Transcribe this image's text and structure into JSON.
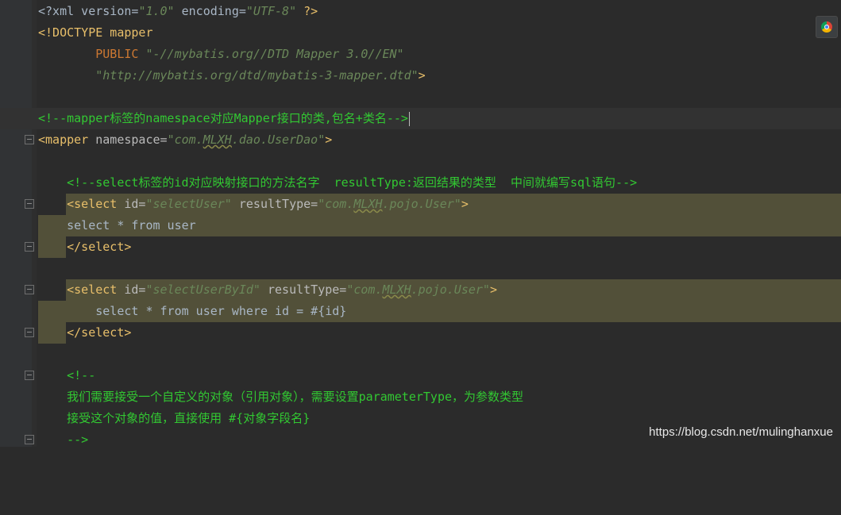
{
  "editor": {
    "lines": {
      "l1": {
        "a": "<?xml version=",
        "b": "\"1.0\"",
        "c": " encoding=",
        "d": "\"UTF-8\"",
        "e": " ?>"
      },
      "l2": {
        "a": "<!DOCTYPE mapper"
      },
      "l3": {
        "a": "        PUBLIC ",
        "b": "\"-//mybatis.org//DTD Mapper 3.0//EN\""
      },
      "l4": {
        "a": "        ",
        "b": "\"http://mybatis.org/dtd/mybatis-3-mapper.dtd\"",
        "c": ">"
      },
      "l6": {
        "a": "<!--mapper标签的namespace对应Mapper接口的类,包名+类名-->"
      },
      "l7": {
        "a": "<mapper",
        "b": " namespace=",
        "c": "\"com.",
        "d": "MLXH",
        "e": ".dao.UserDao\"",
        "f": ">"
      },
      "l9": {
        "a": "    <!--select标签的id对应映射接口的方法名字  resultType:返回结果的类型  中间就编写sql语句-->"
      },
      "l10": {
        "a": "    ",
        "b": "<select",
        "c": " id=",
        "d": "\"selectUser\"",
        "e": " resultType=",
        "f": "\"com.",
        "g": "MLXH",
        "h": ".pojo.User\"",
        "i": ">"
      },
      "l11": {
        "a": "    select * from user"
      },
      "l12": {
        "a": "    ",
        "b": "</select>"
      },
      "l14": {
        "a": "    ",
        "b": "<select",
        "c": " id=",
        "d": "\"selectUserById\"",
        "e": " resultType=",
        "f": "\"com.",
        "g": "MLXH",
        "h": ".pojo.User\"",
        "i": ">"
      },
      "l15": {
        "a": "        select * from user where id = #{id}"
      },
      "l16": {
        "a": "    ",
        "b": "</select>"
      },
      "l18": {
        "a": "    <!--"
      },
      "l19": {
        "a": "    我们需要接受一个自定义的对象（引用对象），需要设置parameterType，为参数类型"
      },
      "l20": {
        "a": "    接受这个对象的值，直接使用 #{对象字段名}"
      },
      "l21": {
        "a": "    -->"
      }
    }
  },
  "browser_icon": "chrome-icon",
  "watermark": "https://blog.csdn.net/mulinghanxue",
  "colors": {
    "background": "#2b2b2b",
    "tag": "#e8bf6a",
    "string": "#6a8759",
    "comment": "#32c832",
    "highlight": "#525039"
  }
}
